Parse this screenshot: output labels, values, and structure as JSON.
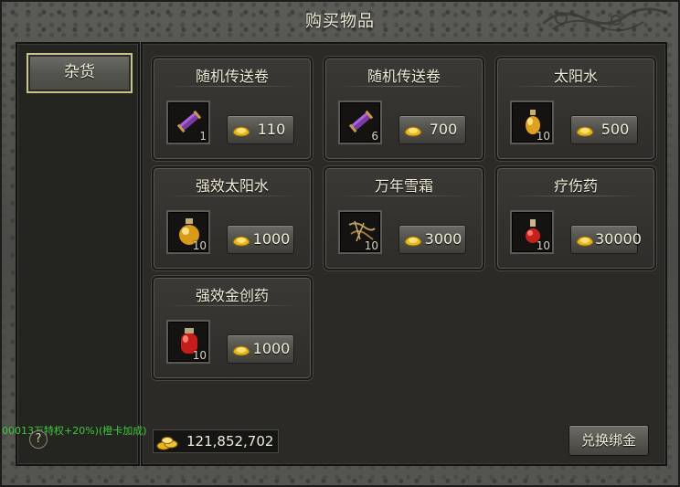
{
  "window": {
    "title": "购买物品"
  },
  "sidebar": {
    "categories": [
      {
        "label": "杂货",
        "selected": true
      }
    ]
  },
  "items": [
    {
      "name": "随机传送卷",
      "qty": "1",
      "price": "110",
      "icon": "scroll-icon"
    },
    {
      "name": "随机传送卷",
      "qty": "6",
      "price": "700",
      "icon": "scroll-icon"
    },
    {
      "name": "太阳水",
      "qty": "10",
      "price": "500",
      "icon": "sun-water-potion-icon"
    },
    {
      "name": "强效太阳水",
      "qty": "10",
      "price": "1000",
      "icon": "strong-sun-water-icon"
    },
    {
      "name": "万年雪霜",
      "qty": "10",
      "price": "3000",
      "icon": "snow-frost-icon"
    },
    {
      "name": "疗伤药",
      "qty": "10",
      "price": "30000",
      "icon": "healing-potion-icon"
    },
    {
      "name": "强效金创药",
      "qty": "10",
      "price": "1000",
      "icon": "strong-wound-medicine-icon"
    }
  ],
  "footer": {
    "status_text": "00013万特权+20%)(橙卡加成)",
    "help_label": "?",
    "balance": "121,852,702",
    "redeem_label": "兑换绑金"
  },
  "colors": {
    "gold": "#e8b51c",
    "status_green": "#3ec93a",
    "selected_border": "#c9c58a"
  }
}
